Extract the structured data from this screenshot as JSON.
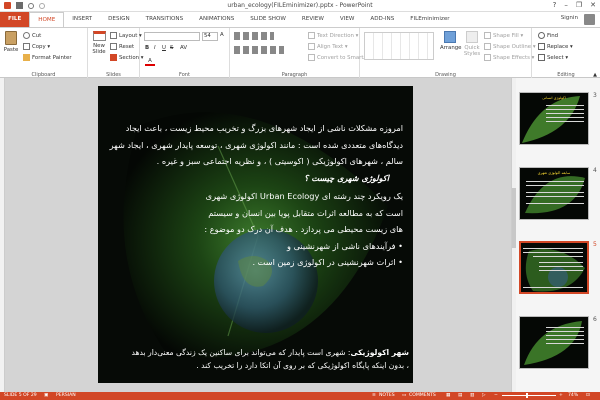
{
  "window": {
    "title": "urban_ecology(FILEminimizer).pptx - PowerPoint",
    "controls": {
      "help": "?",
      "minimize": "–",
      "restore": "❐",
      "close": "✕"
    }
  },
  "user": {
    "name": "Signin"
  },
  "tabs": [
    "FILE",
    "HOME",
    "INSERT",
    "DESIGN",
    "TRANSITIONS",
    "ANIMATIONS",
    "SLIDE SHOW",
    "REVIEW",
    "VIEW",
    "ADD-INS",
    "FILEminimizer"
  ],
  "ribbon": {
    "clipboard": {
      "label": "Clipboard",
      "paste": "Paste",
      "cut": "Cut",
      "copy": "Copy",
      "format_painter": "Format Painter"
    },
    "slides": {
      "label": "Slides",
      "new_slide": "New Slide",
      "layout": "Layout",
      "reset": "Reset",
      "section": "Section"
    },
    "font": {
      "label": "Font",
      "size": "54",
      "bold": "B",
      "italic": "I",
      "underline": "U",
      "strike": "S",
      "aa": "AV"
    },
    "paragraph": {
      "label": "Paragraph",
      "text_direction": "Text Direction",
      "align_text": "Align Text",
      "convert_smartart": "Convert to SmartArt"
    },
    "drawing": {
      "label": "Drawing",
      "arrange": "Arrange",
      "quick_styles": "Quick Styles",
      "shape_fill": "Shape Fill",
      "shape_outline": "Shape Outline",
      "shape_effects": "Shape Effects"
    },
    "editing": {
      "label": "Editing",
      "find": "Find",
      "replace": "Replace",
      "select": "Select"
    }
  },
  "slide": {
    "lines": [
      "امروزه مشکلات ناشی از ایجاد شهرهای بزرگ و تخریب محیط زیست ، باعث ایجاد",
      "دیدگاه‌های متعددی شده است : مانند اکولوژی شهری ، توسعه پایدار شهری ، ایجاد شهر",
      "سالم ، شهرهای اکولوژیکی ( اکوسیتی ) ، و نظریه اجتماعی سبز و غیره .",
      "اکولوژی شهری چیست ؟",
      "یک رویکرد چند رشته ای Urban Ecology اکولوژی شهری",
      "است که به مطالعه اثرات متقابل پویا بین انسان و سیستم",
      "های زیست محیطی می پردازد . هدف آن درک دو موضوع :",
      "فرآیندهای ناشی از شهرنشینی و",
      "اثرات شهرنشینی در اکولوژی زمین است ."
    ],
    "bullet": "•",
    "footer_bold": "شهر اکولوژیکی",
    "footer_rest": ": شهری است پایدار که می‌تواند برای ساکنین یک زندگی معنی‌دار بدهد",
    "footer_line2": "، بدون اینکه پایگاه اکولوژیکی که بر روی آن اتکا دارد را تخریب کند ."
  },
  "thumbnails": [
    {
      "num": "3",
      "title": "اکولوژی انسانی",
      "title_color": "#ffdd33"
    },
    {
      "num": "4",
      "title": "سابقه اکولوژی شهری",
      "title_color": "#ffdd33"
    },
    {
      "num": "5",
      "title": "",
      "selected": true
    },
    {
      "num": "6",
      "title": "",
      "title_color": "#ffdd33"
    }
  ],
  "status": {
    "slide": "SLIDE 5 OF 29",
    "language": "PERSIAN",
    "notes": "NOTES",
    "comments": "COMMENTS",
    "zoom": "74%"
  },
  "colors": {
    "accent": "#d24726",
    "slide_bg": "#060a06",
    "thumb_title": "#ffdd33"
  }
}
